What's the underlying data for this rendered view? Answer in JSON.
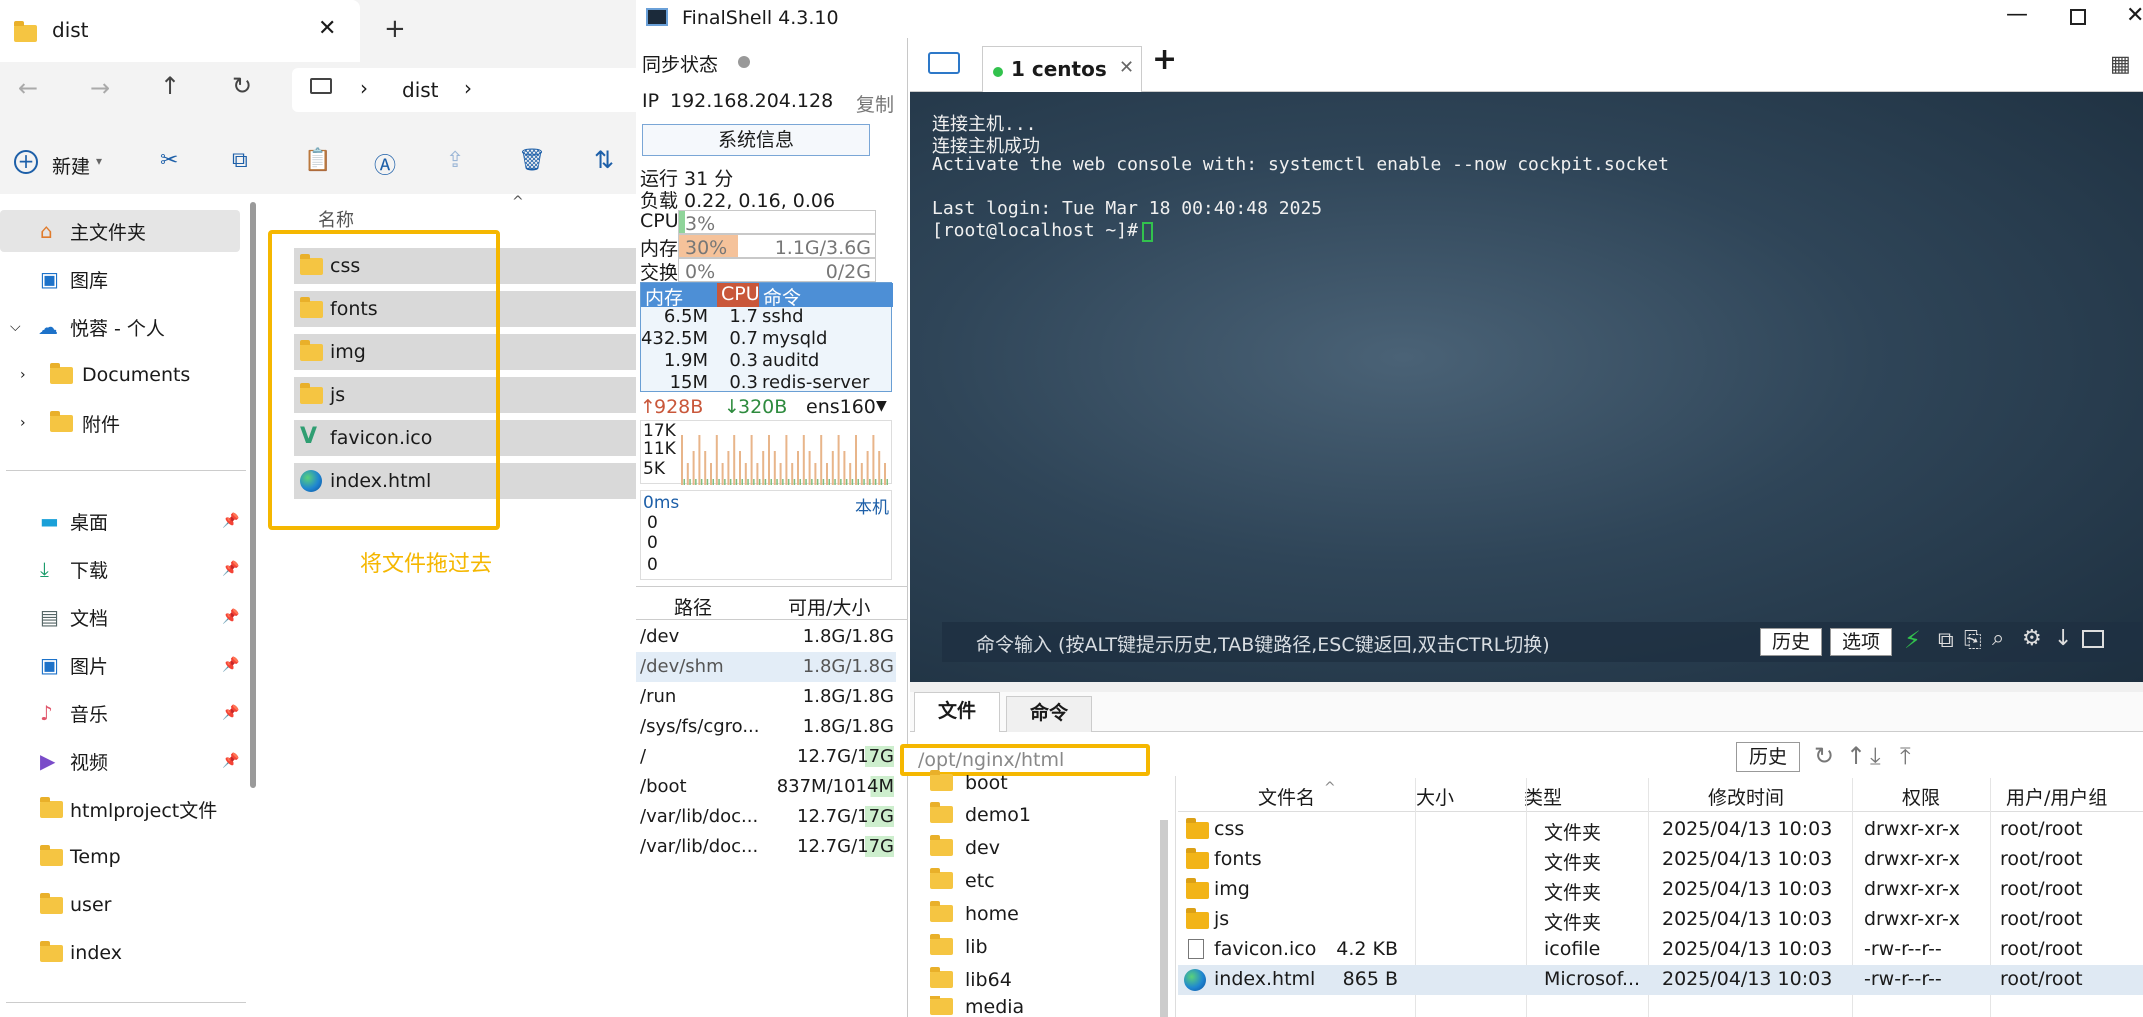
{
  "explorer": {
    "tab_title": "dist",
    "new_tab": "+",
    "address": [
      "dist"
    ],
    "new_label": "新建",
    "col_name": "名称",
    "sidebar": [
      {
        "label": "主文件夹",
        "icon": "home-icon",
        "selected": true
      },
      {
        "label": "图库",
        "icon": "gallery-icon"
      },
      {
        "label": "悦蓉 - 个人",
        "icon": "onedrive-cloud-icon"
      },
      {
        "label": "Documents",
        "icon": "folder-icon"
      },
      {
        "label": "附件",
        "icon": "folder-icon"
      },
      {
        "label": "桌面",
        "icon": "desktop-icon",
        "pinned": true
      },
      {
        "label": "下载",
        "icon": "download-icon",
        "pinned": true
      },
      {
        "label": "文档",
        "icon": "document-icon",
        "pinned": true
      },
      {
        "label": "图片",
        "icon": "picture-icon",
        "pinned": true
      },
      {
        "label": "音乐",
        "icon": "music-icon",
        "pinned": true
      },
      {
        "label": "视频",
        "icon": "video-icon",
        "pinned": true
      },
      {
        "label": "htmlproject文件",
        "icon": "folder-icon"
      },
      {
        "label": "Temp",
        "icon": "folder-icon"
      },
      {
        "label": "user",
        "icon": "folder-icon"
      },
      {
        "label": "index",
        "icon": "folder-icon"
      }
    ],
    "files": [
      {
        "name": "css",
        "icon": "folder-icon"
      },
      {
        "name": "fonts",
        "icon": "folder-icon"
      },
      {
        "name": "img",
        "icon": "folder-icon"
      },
      {
        "name": "js",
        "icon": "folder-icon"
      },
      {
        "name": "favicon.ico",
        "icon": "vue-logo-icon"
      },
      {
        "name": "index.html",
        "icon": "edge-icon"
      }
    ],
    "annotation": "将文件拖过去",
    "accent": "#f5b700"
  },
  "finalshell": {
    "title": "FinalShell 4.3.10",
    "sync_label": "同步状态",
    "ip_label": "IP",
    "ip": "192.168.204.128",
    "copy": "复制",
    "sysinfo_btn": "系统信息",
    "uptime": "运行 31 分",
    "load": "负载 0.22, 0.16, 0.06",
    "cpu_label": "CPU",
    "cpu_value": "3%",
    "mem_label": "内存",
    "mem_pct": "30%",
    "mem_value": "1.1G/3.6G",
    "swap_label": "交换",
    "swap_pct": "0%",
    "swap_value": "0/2G",
    "proc_headers": [
      "内存",
      "CPU",
      "命令"
    ],
    "procs": [
      {
        "mem": "6.5M",
        "cpu": "1.7",
        "cmd": "sshd"
      },
      {
        "mem": "432.5M",
        "cpu": "0.7",
        "cmd": "mysqld"
      },
      {
        "mem": "1.9M",
        "cpu": "0.3",
        "cmd": "auditd"
      },
      {
        "mem": "15M",
        "cpu": "0.3",
        "cmd": "redis-server"
      }
    ],
    "net_up": "928B",
    "net_down": "320B",
    "net_iface": "ens160",
    "net_ticks": [
      "17K",
      "11K",
      "5K"
    ],
    "ping_label": "0ms",
    "ping_host": "本机",
    "ping_ticks": [
      "0",
      "0",
      "0"
    ],
    "disk_headers": [
      "路径",
      "可用/大小"
    ],
    "disks": [
      {
        "path": "/dev",
        "size": "1.8G/1.8G"
      },
      {
        "path": "/dev/shm",
        "size": "1.8G/1.8G"
      },
      {
        "path": "/run",
        "size": "1.8G/1.8G"
      },
      {
        "path": "/sys/fs/cgro...",
        "size": "1.8G/1.8G"
      },
      {
        "path": "/",
        "size": "12.7G/17G"
      },
      {
        "path": "/boot",
        "size": "837M/1014M"
      },
      {
        "path": "/var/lib/doc...",
        "size": "12.7G/17G"
      },
      {
        "path": "/var/lib/doc...",
        "size": "12.7G/17G"
      }
    ],
    "session_tab": "1 centos",
    "add_tab": "+",
    "terminal": [
      "连接主机...",
      "连接主机成功",
      "Activate the web console with: systemctl enable --now cockpit.socket",
      "",
      "Last login: Tue Mar 18 00:40:48 2025",
      "[root@localhost ~]# "
    ],
    "cmd_placeholder": "命令输入 (按ALT键提示历史,TAB键路径,ESC键返回,双击CTRL切换)",
    "history_btn": "历史",
    "options_btn": "选项",
    "bottom_tabs": [
      "文件",
      "命令"
    ],
    "path": "/opt/nginx/html",
    "path_history_btn": "历史",
    "dirs": [
      "boot",
      "demo1",
      "dev",
      "etc",
      "home",
      "lib",
      "lib64",
      "media"
    ],
    "file_headers": [
      "文件名",
      "大小",
      "类型",
      "修改时间",
      "权限",
      "用户/用户组"
    ],
    "remote_files": [
      {
        "name": "css",
        "size": "",
        "type": "文件夹",
        "mtime": "2025/04/13 10:03",
        "perm": "drwxr-xr-x",
        "owner": "root/root",
        "icon": "folder-icon"
      },
      {
        "name": "fonts",
        "size": "",
        "type": "文件夹",
        "mtime": "2025/04/13 10:03",
        "perm": "drwxr-xr-x",
        "owner": "root/root",
        "icon": "folder-icon"
      },
      {
        "name": "img",
        "size": "",
        "type": "文件夹",
        "mtime": "2025/04/13 10:03",
        "perm": "drwxr-xr-x",
        "owner": "root/root",
        "icon": "folder-icon"
      },
      {
        "name": "js",
        "size": "",
        "type": "文件夹",
        "mtime": "2025/04/13 10:03",
        "perm": "drwxr-xr-x",
        "owner": "root/root",
        "icon": "folder-icon"
      },
      {
        "name": "favicon.ico",
        "size": "4.2 KB",
        "type": "icofile",
        "mtime": "2025/04/13 10:03",
        "perm": "-rw-r--r--",
        "owner": "root/root",
        "icon": "file-icon"
      },
      {
        "name": "index.html",
        "size": "865 B",
        "type": "Microsof...",
        "mtime": "2025/04/13 10:03",
        "perm": "-rw-r--r--",
        "owner": "root/root",
        "icon": "edge-icon"
      }
    ]
  }
}
